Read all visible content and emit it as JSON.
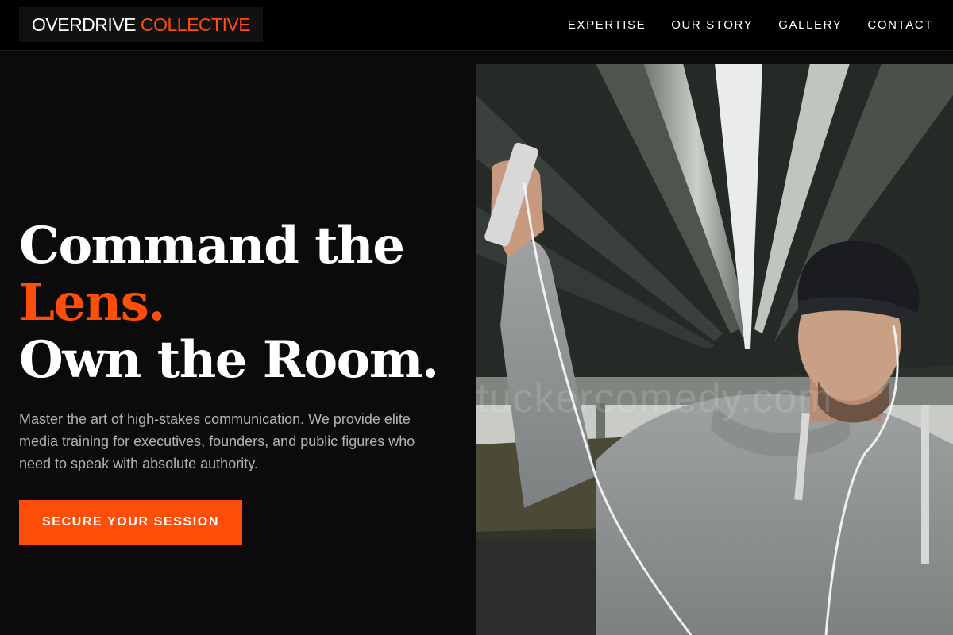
{
  "brand": {
    "name_primary": "OVERDRIVE",
    "name_accent": "COLLECTIVE",
    "accent_color": "#ff4d0a"
  },
  "nav": {
    "items": [
      {
        "label": "EXPERTISE"
      },
      {
        "label": "OUR STORY"
      },
      {
        "label": "GALLERY"
      },
      {
        "label": "CONTACT"
      }
    ]
  },
  "hero": {
    "headline_line1": "Command the",
    "headline_accent": "Lens.",
    "headline_line3": "Own the Room.",
    "description": "Master the art of high-stakes communication. We provide elite media training for executives, founders, and public figures who need to speak with absolute authority.",
    "cta_label": "SECURE YOUR SESSION",
    "image": {
      "subject": "man-taking-selfie-under-overpass",
      "watermark": "tuckercomedy.com"
    }
  }
}
